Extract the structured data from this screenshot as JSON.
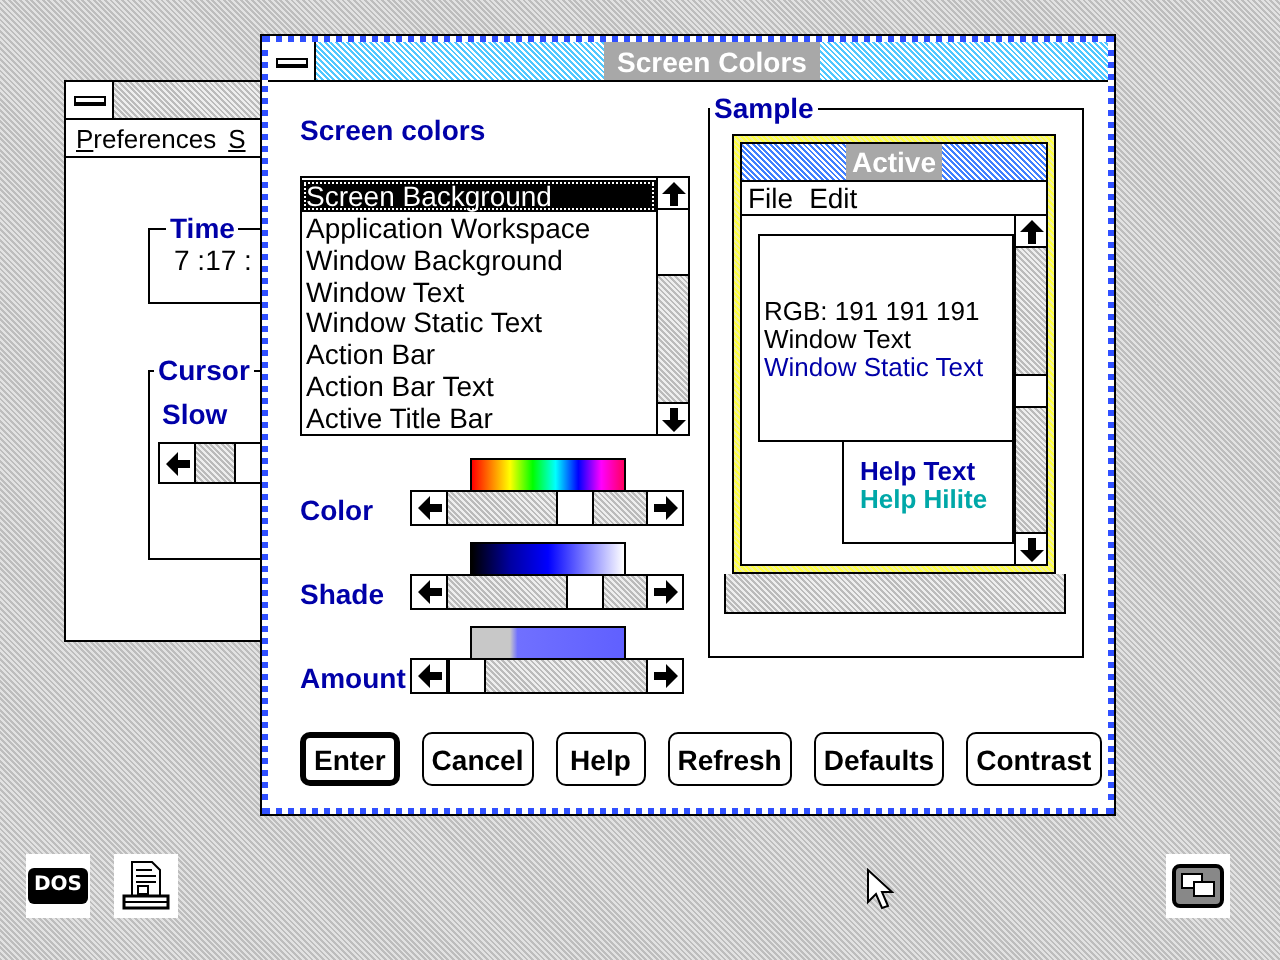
{
  "background_window": {
    "menu": [
      {
        "label": "Preferences"
      },
      {
        "label": "S"
      }
    ],
    "time_group": {
      "title": "Time",
      "value": "7 :17 :"
    },
    "cursor_group": {
      "title": "Cursor",
      "label": "Slow"
    }
  },
  "dialog": {
    "title": "Screen Colors",
    "list_label": "Screen colors",
    "list_items": [
      {
        "label": "Screen Background",
        "selected": true
      },
      {
        "label": "Application Workspace",
        "selected": false
      },
      {
        "label": "Window Background",
        "selected": false
      },
      {
        "label": "Window Text",
        "selected": false
      },
      {
        "label": "Window Static Text",
        "selected": false
      },
      {
        "label": "Action Bar",
        "selected": false
      },
      {
        "label": "Action Bar Text",
        "selected": false
      },
      {
        "label": "Active Title Bar",
        "selected": false
      }
    ],
    "sliders": [
      {
        "label": "Color",
        "kind": "rainbow",
        "level": 0.67
      },
      {
        "label": "Shade",
        "kind": "shade",
        "level": 0.74
      },
      {
        "label": "Amount",
        "kind": "amount",
        "level": 0
      }
    ],
    "sample": {
      "title": "Sample",
      "window_title": "Active",
      "menu": [
        "File",
        "Edit"
      ],
      "rgb": "RGB: 191 191 191",
      "window_text": "Window Text",
      "static_text": "Window Static Text",
      "help_text": "Help Text",
      "help_hilite": "Help Hilite"
    },
    "buttons": [
      {
        "label": "Enter",
        "default": true
      },
      {
        "label": "Cancel",
        "default": false
      },
      {
        "label": "Help",
        "default": false
      },
      {
        "label": "Refresh",
        "default": false
      },
      {
        "label": "Defaults",
        "default": false
      },
      {
        "label": "Contrast",
        "default": false
      }
    ]
  },
  "desktop_icons": [
    {
      "kind": "dos",
      "label": "DOS"
    },
    {
      "kind": "printer"
    },
    {
      "kind": "windows"
    }
  ]
}
